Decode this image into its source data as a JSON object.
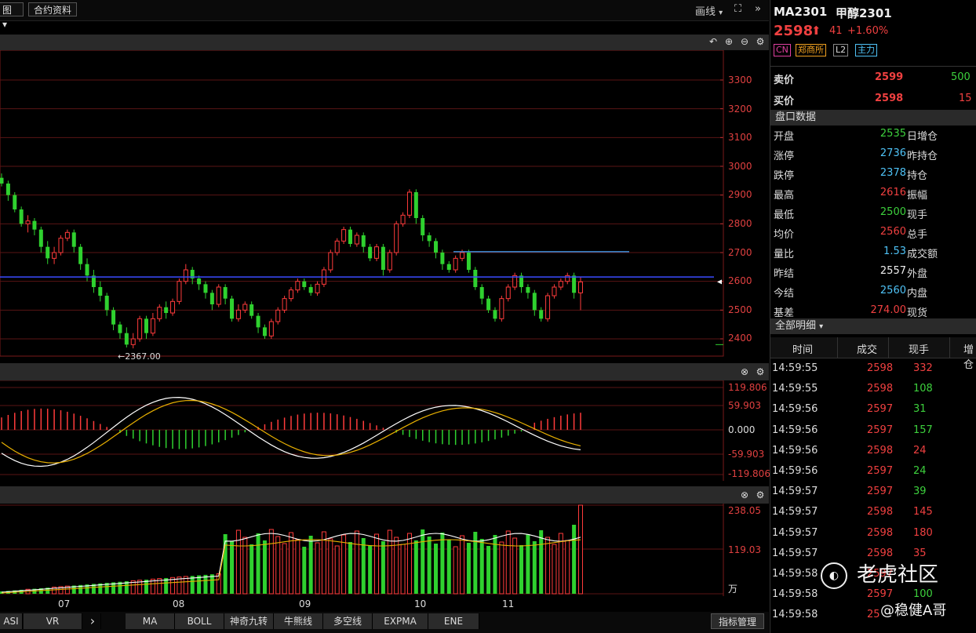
{
  "toolbar": {
    "left_btn1": "图",
    "left_btn2": "合约资料",
    "draw_label": "画线",
    "expand_icon": "⛶",
    "more_icon": "»"
  },
  "price_axis": {
    "labels": [
      "3300",
      "3200",
      "3100",
      "3000",
      "2900",
      "2800",
      "2700",
      "2600",
      "2500",
      "2400"
    ],
    "low_label": "←2367.00"
  },
  "macd_axis": {
    "labels": [
      "119.806",
      "59.903",
      "0.000",
      "-59.903",
      "-119.806"
    ]
  },
  "vol_axis": {
    "labels": [
      "238.05",
      "119.03",
      "万"
    ]
  },
  "date_labels": [
    "07",
    "08",
    "09",
    "10",
    "11"
  ],
  "bottom_tabs": [
    "ASI",
    "VR",
    "MA",
    "BOLL",
    "神奇九转",
    "牛熊线",
    "多空线",
    "EXPMA",
    "ENE"
  ],
  "bottom_next_icon": "›",
  "indicator_mgmt": "指标管理",
  "quote": {
    "symbol": "MA2301",
    "name": "甲醇2301",
    "price": "2598",
    "arrow": "⬆",
    "change": "41",
    "change_pct": "+1.60%",
    "badges": [
      "CN",
      "郑商所",
      "L2",
      "主力"
    ]
  },
  "book": {
    "ask_label": "卖价",
    "ask_price": "2599",
    "ask_vol": "500",
    "bid_label": "买价",
    "bid_price": "2598",
    "bid_vol": "15"
  },
  "panel_title": "盘口数据",
  "stats": [
    {
      "label": "开盘",
      "value": "2535",
      "right": "日增仓",
      "color": "green"
    },
    {
      "label": "涨停",
      "value": "2736",
      "right": "昨持仓",
      "color": "cyan"
    },
    {
      "label": "跌停",
      "value": "2378",
      "right": "持仓",
      "color": "cyan"
    },
    {
      "label": "最高",
      "value": "2616",
      "right": "振幅",
      "color": "red"
    },
    {
      "label": "最低",
      "value": "2500",
      "right": "现手",
      "color": "green"
    },
    {
      "label": "均价",
      "value": "2560",
      "right": "总手",
      "color": "red"
    },
    {
      "label": "量比",
      "value": "1.53",
      "right": "成交额",
      "color": "cyan"
    },
    {
      "label": "昨结",
      "value": "2557",
      "right": "外盘",
      "color": "white"
    },
    {
      "label": "今结",
      "value": "2560",
      "right": "内盘",
      "color": "cyan"
    },
    {
      "label": "基差",
      "value": "274.00",
      "right": "现货",
      "color": "red"
    }
  ],
  "detail_title": "全部明细",
  "trade_headers": [
    "时间",
    "成交",
    "现手",
    "增仓"
  ],
  "trades": [
    {
      "time": "14:59:55",
      "price": "2598",
      "qty": "332",
      "pc": "red",
      "qc": "red"
    },
    {
      "time": "14:59:55",
      "price": "2598",
      "qty": "108",
      "pc": "red",
      "qc": "green"
    },
    {
      "time": "14:59:56",
      "price": "2597",
      "qty": "31",
      "pc": "red",
      "qc": "green"
    },
    {
      "time": "14:59:56",
      "price": "2597",
      "qty": "157",
      "pc": "red",
      "qc": "green"
    },
    {
      "time": "14:59:56",
      "price": "2598",
      "qty": "24",
      "pc": "red",
      "qc": "red"
    },
    {
      "time": "14:59:56",
      "price": "2597",
      "qty": "24",
      "pc": "red",
      "qc": "green"
    },
    {
      "time": "14:59:57",
      "price": "2597",
      "qty": "39",
      "pc": "red",
      "qc": "green"
    },
    {
      "time": "14:59:57",
      "price": "2598",
      "qty": "145",
      "pc": "red",
      "qc": "red"
    },
    {
      "time": "14:59:57",
      "price": "2598",
      "qty": "180",
      "pc": "red",
      "qc": "red"
    },
    {
      "time": "14:59:57",
      "price": "2598",
      "qty": "35",
      "pc": "red",
      "qc": "red"
    },
    {
      "time": "14:59:58",
      "price": "2597",
      "qty": "",
      "pc": "red",
      "qc": "green"
    },
    {
      "time": "14:59:58",
      "price": "2597",
      "qty": "100",
      "pc": "red",
      "qc": "green"
    },
    {
      "time": "14:59:58",
      "price": "25",
      "qty": "",
      "pc": "red",
      "qc": "green"
    }
  ],
  "watermark": {
    "brand": "老虎社区",
    "author": "@稳健A哥"
  },
  "chart_data": {
    "type": "candlestick",
    "x_ticks": [
      "07",
      "08",
      "09",
      "10",
      "11"
    ],
    "ylim": [
      2360,
      3350
    ],
    "candles": [
      [
        2960,
        2940,
        2975,
        2930
      ],
      [
        2940,
        2900,
        2950,
        2880
      ],
      [
        2900,
        2850,
        2910,
        2840
      ],
      [
        2850,
        2800,
        2860,
        2790
      ],
      [
        2800,
        2810,
        2830,
        2770
      ],
      [
        2810,
        2780,
        2820,
        2760
      ],
      [
        2780,
        2720,
        2790,
        2700
      ],
      [
        2720,
        2680,
        2740,
        2660
      ],
      [
        2680,
        2700,
        2720,
        2660
      ],
      [
        2700,
        2750,
        2760,
        2690
      ],
      [
        2750,
        2770,
        2780,
        2740
      ],
      [
        2770,
        2720,
        2780,
        2700
      ],
      [
        2720,
        2660,
        2730,
        2640
      ],
      [
        2660,
        2620,
        2680,
        2600
      ],
      [
        2620,
        2580,
        2640,
        2560
      ],
      [
        2580,
        2550,
        2600,
        2530
      ],
      [
        2550,
        2500,
        2560,
        2480
      ],
      [
        2500,
        2450,
        2510,
        2430
      ],
      [
        2450,
        2420,
        2460,
        2400
      ],
      [
        2420,
        2380,
        2440,
        2370
      ],
      [
        2380,
        2400,
        2420,
        2367
      ],
      [
        2400,
        2470,
        2480,
        2390
      ],
      [
        2470,
        2420,
        2480,
        2400
      ],
      [
        2420,
        2470,
        2490,
        2410
      ],
      [
        2470,
        2510,
        2520,
        2460
      ],
      [
        2510,
        2490,
        2530,
        2470
      ],
      [
        2490,
        2530,
        2540,
        2480
      ],
      [
        2530,
        2600,
        2610,
        2520
      ],
      [
        2600,
        2640,
        2660,
        2590
      ],
      [
        2640,
        2610,
        2650,
        2590
      ],
      [
        2610,
        2590,
        2620,
        2570
      ],
      [
        2590,
        2560,
        2600,
        2540
      ],
      [
        2560,
        2520,
        2570,
        2500
      ],
      [
        2520,
        2580,
        2590,
        2510
      ],
      [
        2580,
        2540,
        2590,
        2520
      ],
      [
        2540,
        2470,
        2550,
        2460
      ],
      [
        2470,
        2500,
        2520,
        2460
      ],
      [
        2500,
        2520,
        2530,
        2490
      ],
      [
        2520,
        2480,
        2530,
        2470
      ],
      [
        2480,
        2440,
        2490,
        2420
      ],
      [
        2440,
        2410,
        2450,
        2400
      ],
      [
        2410,
        2460,
        2470,
        2400
      ],
      [
        2460,
        2500,
        2510,
        2450
      ],
      [
        2500,
        2540,
        2550,
        2490
      ],
      [
        2540,
        2570,
        2580,
        2530
      ],
      [
        2570,
        2600,
        2610,
        2560
      ],
      [
        2600,
        2580,
        2610,
        2570
      ],
      [
        2580,
        2560,
        2590,
        2550
      ],
      [
        2560,
        2590,
        2600,
        2550
      ],
      [
        2590,
        2640,
        2650,
        2580
      ],
      [
        2640,
        2700,
        2710,
        2630
      ],
      [
        2700,
        2740,
        2750,
        2690
      ],
      [
        2740,
        2780,
        2790,
        2730
      ],
      [
        2780,
        2730,
        2790,
        2720
      ],
      [
        2730,
        2760,
        2770,
        2720
      ],
      [
        2760,
        2720,
        2770,
        2700
      ],
      [
        2720,
        2680,
        2730,
        2670
      ],
      [
        2680,
        2720,
        2730,
        2670
      ],
      [
        2720,
        2640,
        2730,
        2620
      ],
      [
        2640,
        2700,
        2710,
        2630
      ],
      [
        2700,
        2800,
        2810,
        2690
      ],
      [
        2800,
        2830,
        2840,
        2790
      ],
      [
        2830,
        2910,
        2920,
        2820
      ],
      [
        2910,
        2820,
        2920,
        2800
      ],
      [
        2820,
        2760,
        2830,
        2740
      ],
      [
        2760,
        2740,
        2770,
        2720
      ],
      [
        2740,
        2700,
        2750,
        2680
      ],
      [
        2700,
        2660,
        2710,
        2640
      ],
      [
        2660,
        2640,
        2670,
        2630
      ],
      [
        2640,
        2680,
        2690,
        2630
      ],
      [
        2680,
        2700,
        2710,
        2670
      ],
      [
        2700,
        2640,
        2710,
        2630
      ],
      [
        2640,
        2580,
        2650,
        2570
      ],
      [
        2580,
        2540,
        2590,
        2520
      ],
      [
        2540,
        2500,
        2550,
        2490
      ],
      [
        2500,
        2470,
        2510,
        2460
      ],
      [
        2470,
        2540,
        2550,
        2460
      ],
      [
        2540,
        2580,
        2590,
        2530
      ],
      [
        2580,
        2620,
        2630,
        2570
      ],
      [
        2620,
        2580,
        2630,
        2560
      ],
      [
        2580,
        2560,
        2590,
        2540
      ],
      [
        2560,
        2500,
        2570,
        2480
      ],
      [
        2500,
        2470,
        2510,
        2460
      ],
      [
        2470,
        2550,
        2560,
        2460
      ],
      [
        2550,
        2580,
        2590,
        2540
      ],
      [
        2580,
        2600,
        2610,
        2570
      ],
      [
        2600,
        2620,
        2630,
        2590
      ],
      [
        2620,
        2560,
        2630,
        2540
      ],
      [
        2560,
        2598,
        2616,
        2500
      ]
    ]
  }
}
